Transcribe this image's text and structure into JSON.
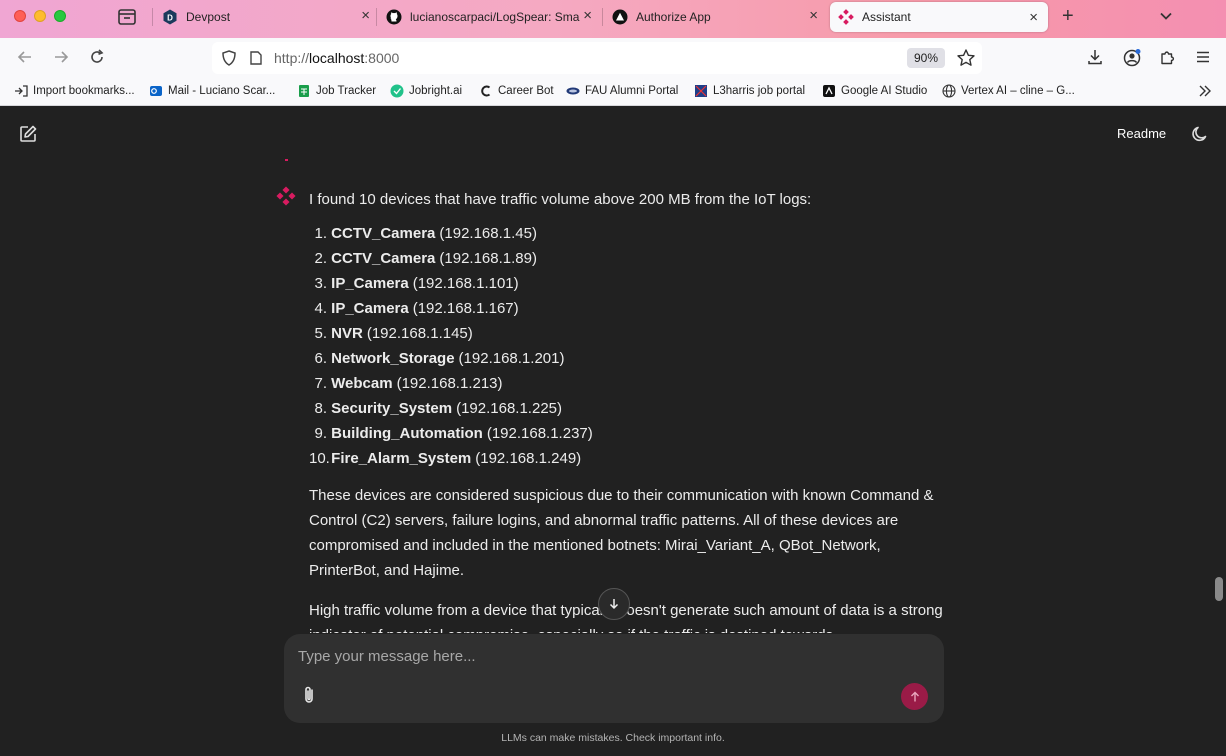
{
  "browser": {
    "tabs": [
      {
        "title": "Devpost",
        "active": false
      },
      {
        "title": "lucianoscarpaci/LogSpear: Smar",
        "active": false
      },
      {
        "title": "Authorize App",
        "active": false
      },
      {
        "title": "Assistant",
        "active": true
      }
    ],
    "url_prefix": "http://",
    "url_host": "localhost",
    "url_suffix": ":8000",
    "zoom": "90%",
    "bookmarks": [
      "Import bookmarks...",
      "Mail - Luciano Scar...",
      "Job Tracker",
      "Jobright.ai",
      "Career Bot",
      "FAU Alumni Portal",
      "L3harris job portal",
      "Google AI Studio",
      "Vertex AI – cline – G..."
    ]
  },
  "app": {
    "header": {
      "readme_label": "Readme"
    },
    "message": {
      "intro": "I found 10 devices that have traffic volume above 200 MB from the IoT logs:",
      "devices": [
        {
          "num": "1.",
          "name": "CCTV_Camera",
          "ip": "(192.168.1.45)"
        },
        {
          "num": "2.",
          "name": "CCTV_Camera",
          "ip": "(192.168.1.89)"
        },
        {
          "num": "3.",
          "name": "IP_Camera",
          "ip": "(192.168.1.101)"
        },
        {
          "num": "4.",
          "name": "IP_Camera",
          "ip": "(192.168.1.167)"
        },
        {
          "num": "5.",
          "name": "NVR",
          "ip": "(192.168.1.145)"
        },
        {
          "num": "6.",
          "name": "Network_Storage",
          "ip": "(192.168.1.201)"
        },
        {
          "num": "7.",
          "name": "Webcam",
          "ip": "(192.168.1.213)"
        },
        {
          "num": "8.",
          "name": "Security_System",
          "ip": "(192.168.1.225)"
        },
        {
          "num": "9.",
          "name": "Building_Automation",
          "ip": "(192.168.1.237)"
        },
        {
          "num": "10.",
          "name": "Fire_Alarm_System",
          "ip": "(192.168.1.249)"
        }
      ],
      "paragraph1": "These devices are considered suspicious due to their communication with known Command & Control (C2) servers, failure logins, and abnormal traffic patterns. All of these devices are compromised and included in the mentioned botnets: Mirai_Variant_A, QBot_Network, PrinterBot, and Hajime.",
      "paragraph2": "High traffic volume from a device that typically doesn't generate such amount of data is a strong indicator of potential compromise, especially so if the traffic is destined towards"
    },
    "composer": {
      "placeholder": "Type your message here...",
      "value": ""
    },
    "disclaimer": "LLMs can make mistakes. Check important info."
  },
  "colors": {
    "background": "#212121",
    "composer": "#303030",
    "accent": "#d81b60",
    "send_button": "#9a1b47"
  }
}
